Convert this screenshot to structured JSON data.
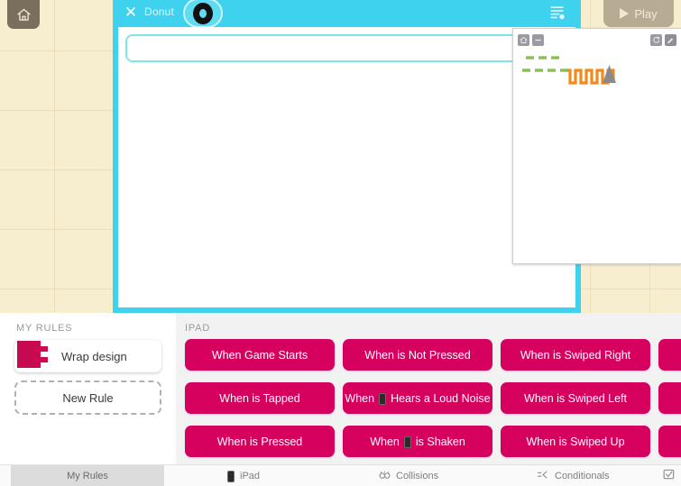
{
  "app": {
    "home_icon": "home-icon",
    "play_label": "Play"
  },
  "editor": {
    "close_icon": "close-x-icon",
    "object_name": "Donut",
    "object_avatar_icon": "donut-ring-icon",
    "document_icon": "document-list-icon",
    "rule_input_value": "",
    "rule_input_placeholder": ""
  },
  "preview_panel": {
    "home_icon": "home-icon",
    "minimize_icon": "minimize-icon",
    "reload_icon": "reload-icon",
    "edit_icon": "pencil-edit-icon",
    "artwork_icon": "square-wave-artwork"
  },
  "my_rules": {
    "header": "MY RULES",
    "rule_card_label": "Wrap design",
    "rule_card_icon": "puzzle-piece-icon",
    "new_rule_label": "New Rule"
  },
  "ipad_section": {
    "header": "IPAD",
    "buttons": [
      {
        "label": "When Game Starts",
        "icon": null,
        "col": 0,
        "row": 0
      },
      {
        "label": "When is Not Pressed",
        "icon": null,
        "col": 1,
        "row": 0
      },
      {
        "label": "When is Swiped Right",
        "icon": null,
        "col": 2,
        "row": 0
      },
      {
        "label": "",
        "icon": null,
        "col": 3,
        "row": 0
      },
      {
        "label": "When is Tapped",
        "icon": null,
        "col": 0,
        "row": 1
      },
      {
        "label": "Hears a Loud Noise",
        "prefix": "When",
        "icon": "ipad-device-icon",
        "col": 1,
        "row": 1
      },
      {
        "label": "When is Swiped Left",
        "icon": null,
        "col": 2,
        "row": 1
      },
      {
        "label": "",
        "icon": null,
        "col": 3,
        "row": 1
      },
      {
        "label": "When is Pressed",
        "icon": null,
        "col": 0,
        "row": 2
      },
      {
        "label": "is Shaken",
        "prefix": "When",
        "icon": "ipad-device-icon",
        "col": 1,
        "row": 2
      },
      {
        "label": "When is Swiped Up",
        "icon": null,
        "col": 2,
        "row": 2
      },
      {
        "label": "",
        "icon": null,
        "col": 3,
        "row": 2
      }
    ]
  },
  "tabbar": {
    "my_rules": "My Rules",
    "ipad": "iPad",
    "collisions": "Collisions",
    "conditionals": "Conditionals"
  },
  "colors": {
    "cyan_frame": "#3fd2ee",
    "magenta_button": "#d6005e",
    "cream_bg": "#f7eed0",
    "play_disabled": "#b7ab93",
    "puzzle_pink": "#cf0a55"
  }
}
